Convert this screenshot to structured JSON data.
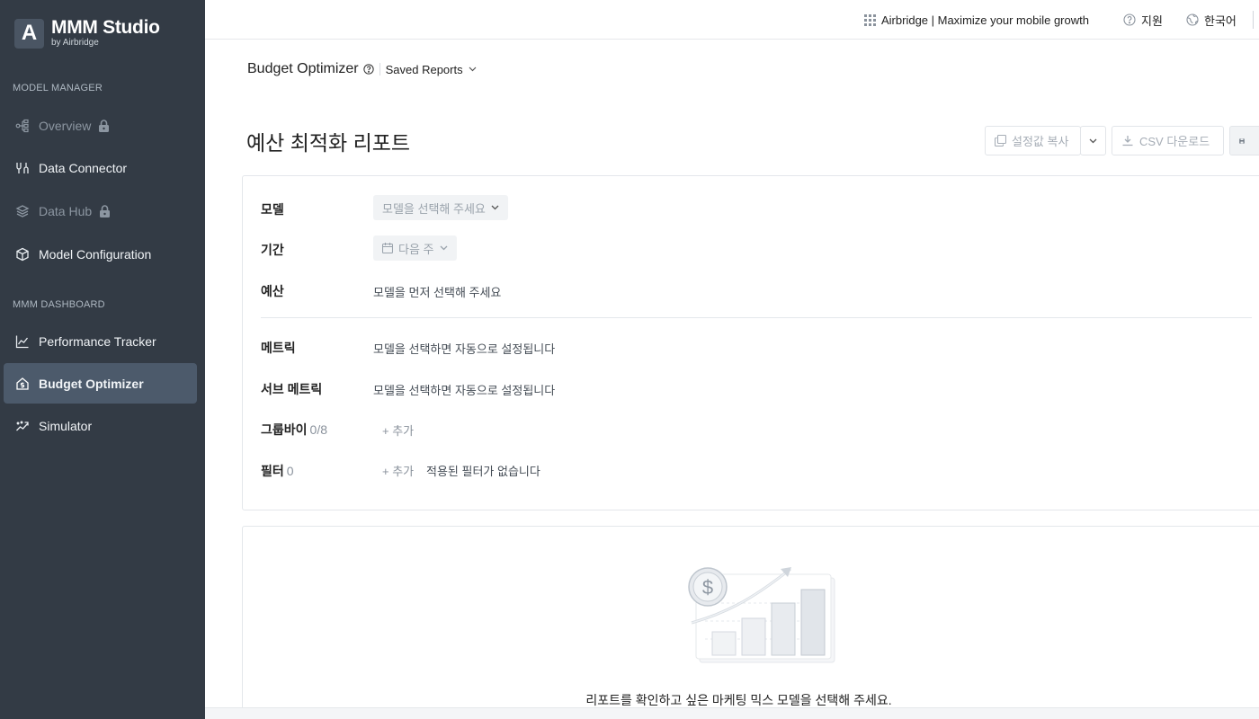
{
  "app": {
    "logo_letter": "A",
    "logo_title": "MMM Studio",
    "logo_subtitle": "by Airbridge"
  },
  "sidebar": {
    "section_model_manager": "MODEL MANAGER",
    "section_dashboard": "MMM DASHBOARD",
    "items": [
      {
        "label": "Overview",
        "icon": "overview-icon",
        "locked": true,
        "disabled": true
      },
      {
        "label": "Data Connector",
        "icon": "data-connector-icon",
        "locked": false,
        "disabled": false
      },
      {
        "label": "Data Hub",
        "icon": "data-hub-icon",
        "locked": true,
        "disabled": true
      },
      {
        "label": "Model Configuration",
        "icon": "cube-icon",
        "locked": false,
        "disabled": false
      },
      {
        "label": "Performance Tracker",
        "icon": "line-chart-icon",
        "locked": false,
        "disabled": false
      },
      {
        "label": "Budget Optimizer",
        "icon": "home-dollar-icon",
        "locked": false,
        "disabled": false,
        "active": true
      },
      {
        "label": "Simulator",
        "icon": "trend-icon",
        "locked": false,
        "disabled": false
      }
    ]
  },
  "topbar": {
    "product_link": "Airbridge | Maximize your mobile growth",
    "support": "지원",
    "language": "한국어"
  },
  "header": {
    "breadcrumb_title": "Budget Optimizer",
    "saved_reports": "Saved Reports"
  },
  "page": {
    "title": "예산 최적화 리포트",
    "copy_settings_button": "설정값 복사",
    "csv_download_button": "CSV 다운로드"
  },
  "form": {
    "model_label": "모델",
    "model_placeholder": "모델을 선택해 주세요",
    "period_label": "기간",
    "period_value": "다음 주",
    "budget_label": "예산",
    "budget_value": "모델을 먼저 선택해 주세요",
    "metric_label": "메트릭",
    "metric_value": "모델을 선택하면 자동으로 설정됩니다",
    "sub_metric_label": "서브 메트릭",
    "sub_metric_value": "모델을 선택하면 자동으로 설정됩니다",
    "group_by_label": "그룹바이",
    "group_by_count": "0/8",
    "group_by_add": "+ 추가",
    "filter_label": "필터",
    "filter_count": "0",
    "filter_add": "+ 추가",
    "filter_empty": "적용된 필터가 없습니다"
  },
  "empty_state": {
    "message": "리포트를 확인하고 싶은 마케팅 믹스 모델을 선택해 주세요."
  },
  "colors": {
    "sidebar_bg": "#333b45",
    "sidebar_active_bg": "#4c5a6b",
    "border": "#e4e7eb"
  }
}
